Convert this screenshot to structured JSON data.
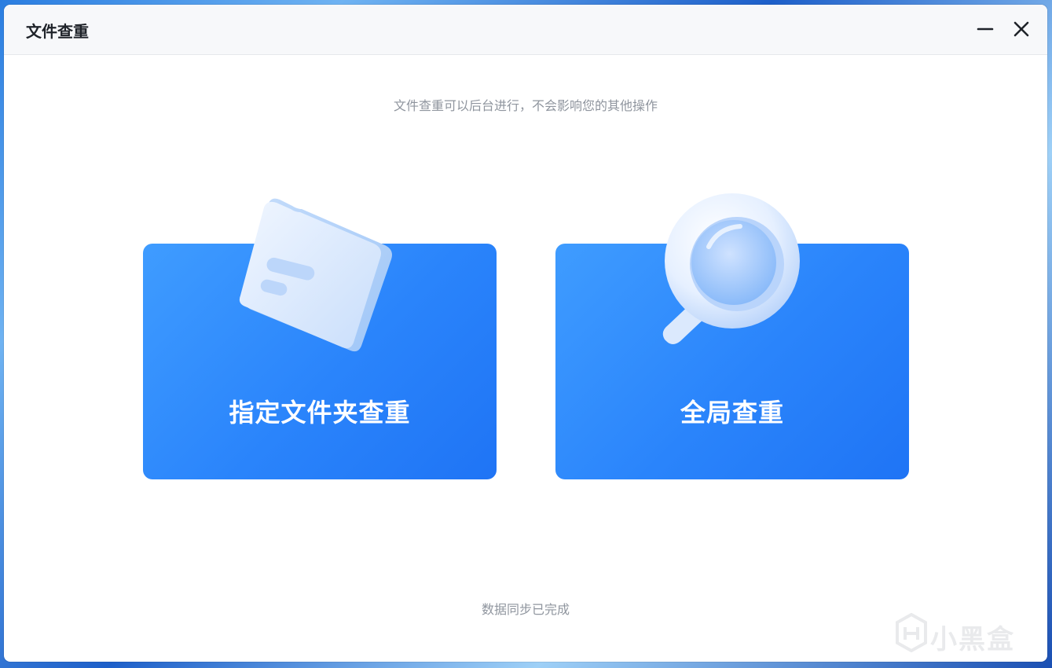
{
  "window": {
    "title": "文件查重"
  },
  "controls": {
    "minimize_icon": "minimize-icon",
    "close_icon": "close-icon"
  },
  "main": {
    "subtitle": "文件查重可以后台进行，不会影响您的其他操作",
    "cards": [
      {
        "label": "指定文件夹查重",
        "icon": "folder-icon"
      },
      {
        "label": "全局查重",
        "icon": "magnifier-icon"
      }
    ],
    "status": "数据同步已完成"
  },
  "watermark": {
    "text": "小黑盒"
  },
  "colors": {
    "card_start": "#3f9cff",
    "card_end": "#1f74f5",
    "muted_text": "#8f959e",
    "title_text": "#1f2329"
  }
}
